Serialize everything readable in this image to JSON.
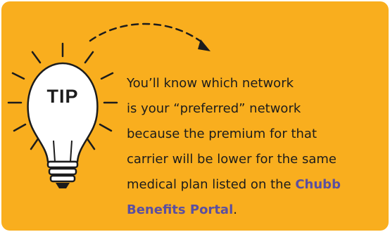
{
  "tip": {
    "icon_label": "TIP",
    "message": {
      "line1": "You’ll know which network",
      "line2": "is your “preferred” network",
      "line3": "because the premium for that",
      "line4": "carrier will be lower for the same",
      "line5_prefix": "medical plan listed on the ",
      "link_part1": "Chubb",
      "link_part2": "Benefits Portal",
      "line6_suffix": "."
    }
  },
  "colors": {
    "background": "#f9ae1e",
    "text": "#1c1c1c",
    "link": "#5b4fa0",
    "bulb_fill": "#ffffff",
    "outline": "#1c1c1c"
  },
  "icons": [
    "lightbulb-icon",
    "dashed-arrow-icon"
  ]
}
